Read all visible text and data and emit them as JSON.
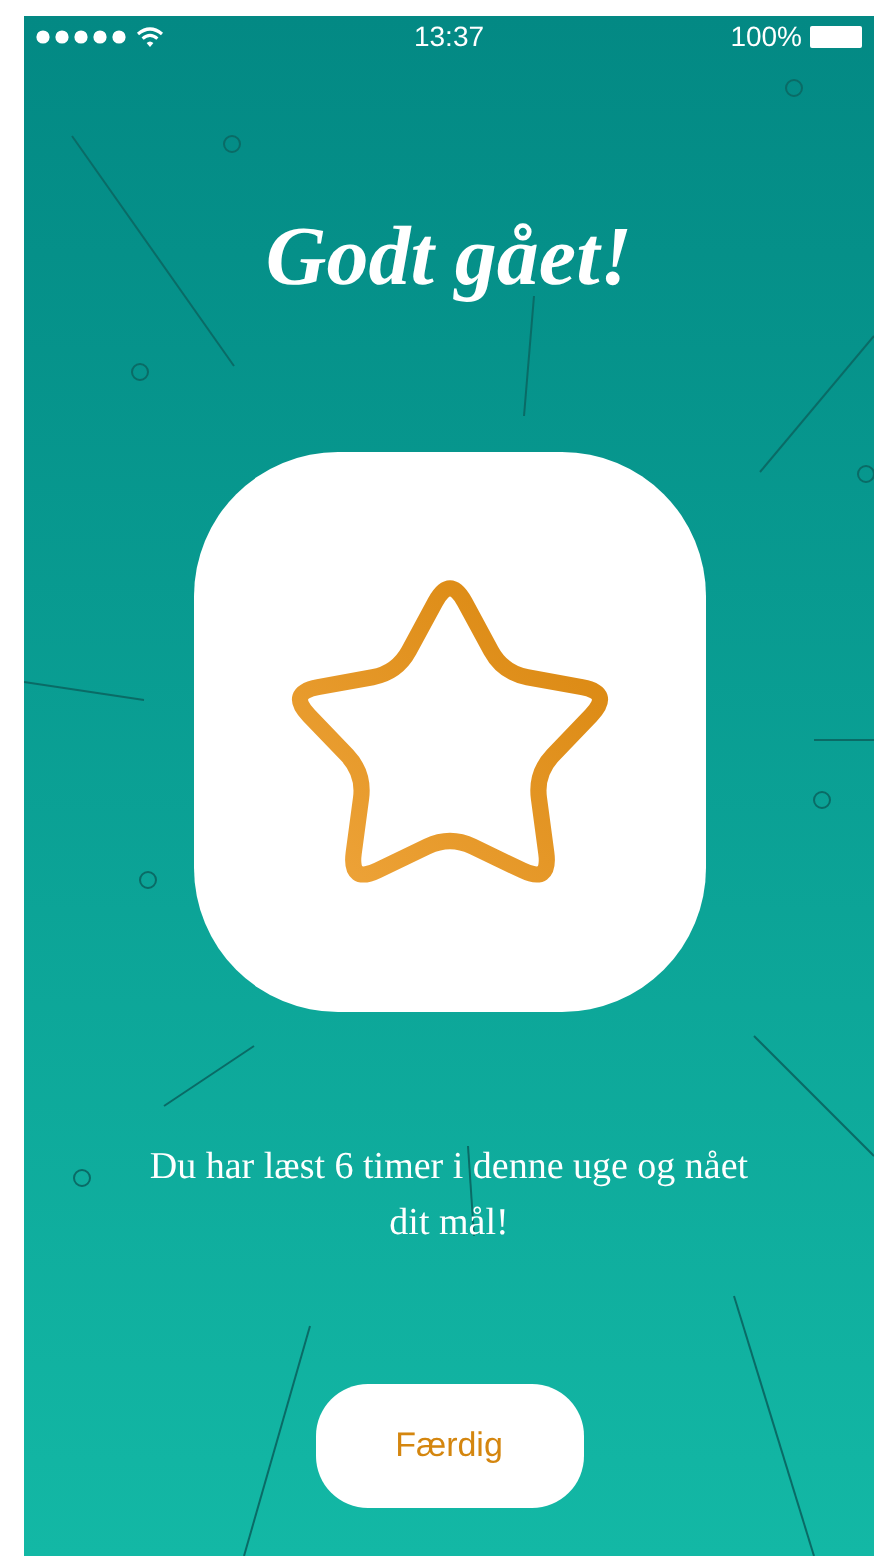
{
  "status_bar": {
    "time": "13:37",
    "battery": "100%"
  },
  "title": "Godt gået!",
  "message": "Du har læst 6 timer i denne uge og nået dit mål!",
  "button": {
    "label": "Færdig"
  }
}
